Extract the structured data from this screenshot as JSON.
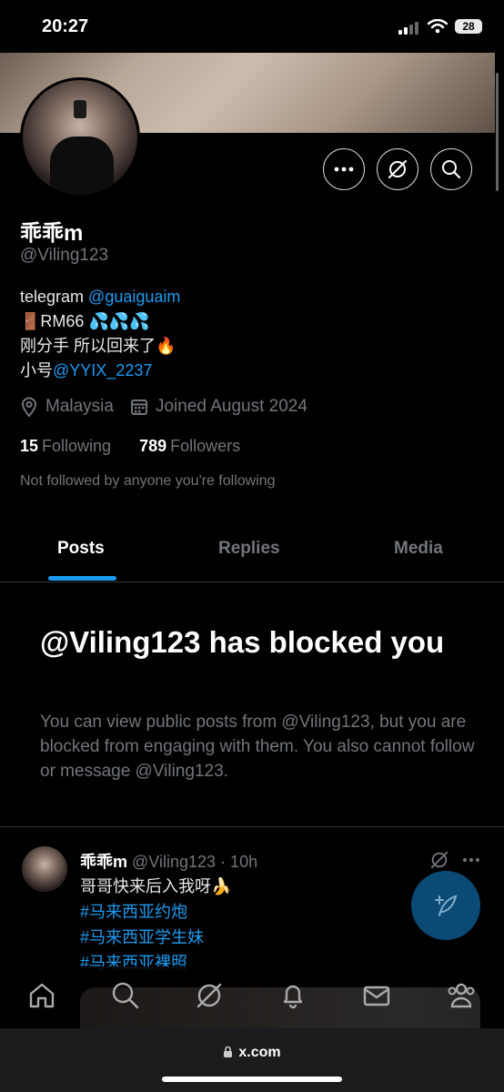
{
  "status_bar": {
    "time": "20:27",
    "battery": "28"
  },
  "profile": {
    "name": "乖乖m",
    "handle": "@Viling123",
    "bio": {
      "line1_prefix": "telegram ",
      "line1_link": "@guaiguaim",
      "line2_prefix": "🚪",
      "line2_text": "RM66 ",
      "line2_suffix": "💦💦💦",
      "line3_text": "刚分手 所以回来了",
      "line3_emoji": "🔥",
      "line4_prefix": "小号",
      "line4_link": "@YYIX_2237"
    },
    "location": "Malaysia",
    "joined": "Joined August 2024",
    "following_count": "15",
    "following_label": "Following",
    "followers_count": "789",
    "followers_label": "Followers",
    "not_followed": "Not followed by anyone you're following"
  },
  "tabs": [
    {
      "label": "Posts",
      "active": true
    },
    {
      "label": "Replies",
      "active": false
    },
    {
      "label": "Media",
      "active": false
    }
  ],
  "blocked": {
    "title": "@Viling123 has blocked you",
    "description": "You can view public posts from @Viling123, but you are blocked from engaging with them. You also cannot follow or message @Viling123."
  },
  "tweet": {
    "name": "乖乖m",
    "handle": "@Viling123",
    "time": "· 10h",
    "text": "哥哥快来后入我呀",
    "emoji": "🍌",
    "hashtags": [
      "#马来西亚约炮",
      "#马来西亚学生妹",
      "#马来西亚裸照"
    ]
  },
  "browser": {
    "url": "x.com"
  },
  "icons": {
    "more": "more-icon",
    "grok": "grok-icon",
    "search": "search-icon",
    "location": "location-icon",
    "calendar": "calendar-icon",
    "home": "home-icon",
    "bell": "bell-icon",
    "mail": "mail-icon",
    "communities": "communities-icon",
    "compose": "compose-icon",
    "lock": "lock-icon"
  },
  "colors": {
    "accent": "#1d9bf0",
    "muted": "#71767b",
    "background": "#000000"
  }
}
